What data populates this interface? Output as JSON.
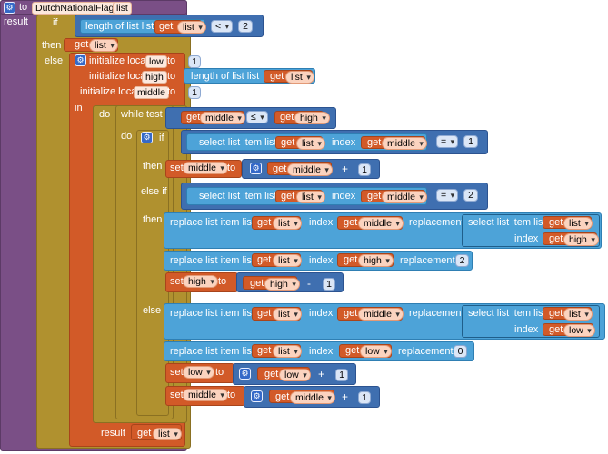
{
  "header": {
    "to": "to",
    "proc_name": "DutchNationalFlag",
    "param": "list",
    "result": "result"
  },
  "kw": {
    "if": "if",
    "then": "then",
    "else": "else",
    "else_if": "else if",
    "do": "do",
    "while": "while",
    "test": "test",
    "in": "in",
    "to": "to",
    "set": "set",
    "initialize_local": "initialize local",
    "length_of_list": "length of list",
    "list": "list",
    "select_list_item": "select list item",
    "index": "index",
    "replace_list_item": "replace list item",
    "replacement": "replacement",
    "get": "get",
    "result": "result"
  },
  "vars": {
    "list": "list",
    "low": "low",
    "high": "high",
    "middle": "middle"
  },
  "ops": {
    "lt": "<",
    "le": "≤",
    "eq": "=",
    "plus": "+",
    "minus": "-"
  },
  "nums": {
    "zero": "0",
    "one": "1",
    "two": "2"
  },
  "colors": {
    "procedure": "#7a4f86",
    "control": "#b0912f",
    "variables": "#d25a28",
    "lists": "#4da3d8",
    "math": "#3f6fb0"
  }
}
